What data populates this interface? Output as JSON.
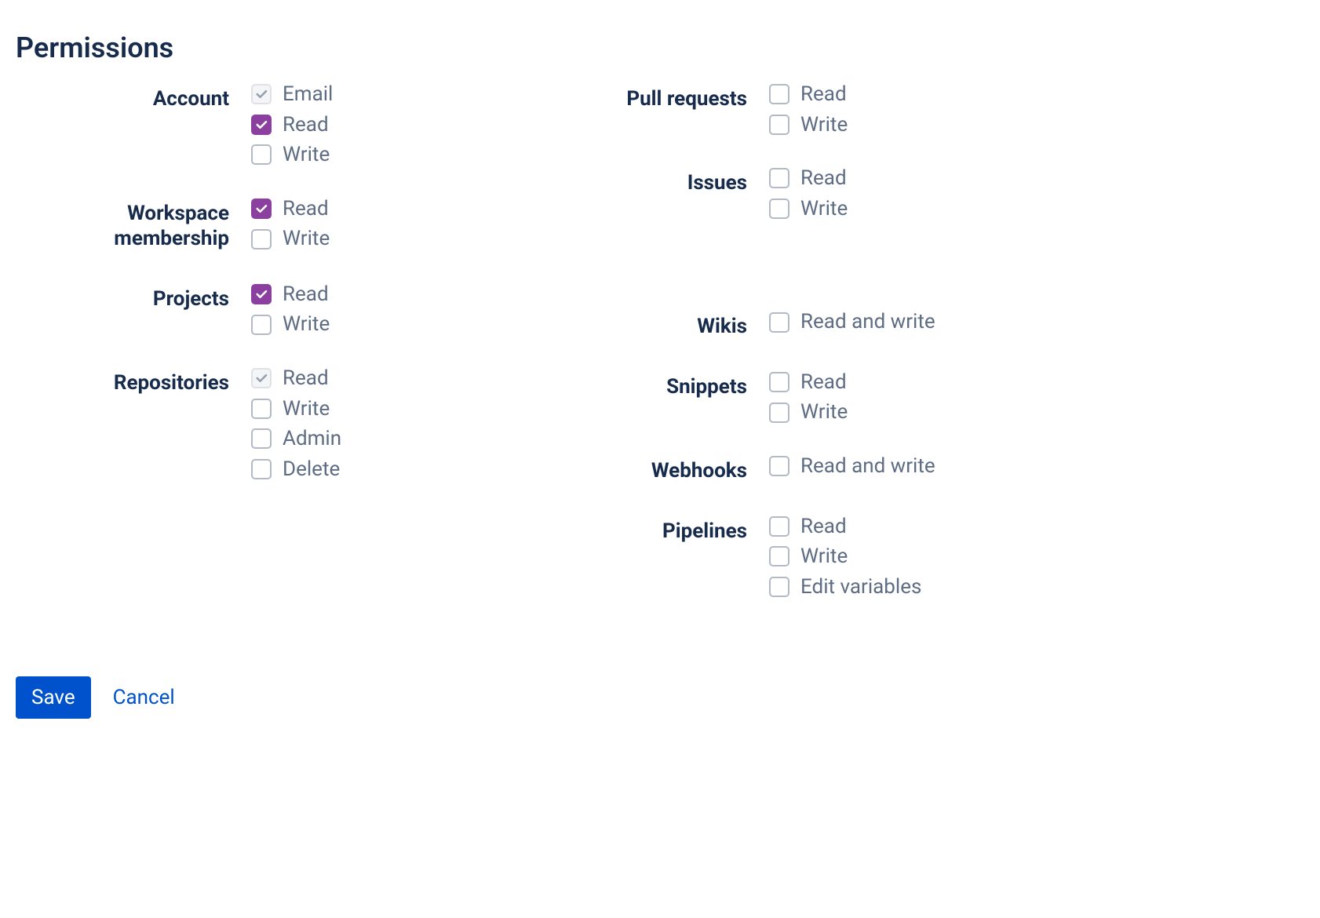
{
  "title": "Permissions",
  "buttons": {
    "save": "Save",
    "cancel": "Cancel"
  },
  "left": [
    {
      "name": "account",
      "label": "Account",
      "options": [
        {
          "name": "email",
          "label": "Email",
          "checked": true,
          "disabled": true
        },
        {
          "name": "read",
          "label": "Read",
          "checked": true,
          "disabled": false
        },
        {
          "name": "write",
          "label": "Write",
          "checked": false,
          "disabled": false
        }
      ]
    },
    {
      "name": "workspace-membership",
      "label": "Workspace membership",
      "options": [
        {
          "name": "read",
          "label": "Read",
          "checked": true,
          "disabled": false
        },
        {
          "name": "write",
          "label": "Write",
          "checked": false,
          "disabled": false
        }
      ]
    },
    {
      "name": "projects",
      "label": "Projects",
      "options": [
        {
          "name": "read",
          "label": "Read",
          "checked": true,
          "disabled": false
        },
        {
          "name": "write",
          "label": "Write",
          "checked": false,
          "disabled": false
        }
      ]
    },
    {
      "name": "repositories",
      "label": "Repositories",
      "options": [
        {
          "name": "read",
          "label": "Read",
          "checked": true,
          "disabled": true
        },
        {
          "name": "write",
          "label": "Write",
          "checked": false,
          "disabled": false
        },
        {
          "name": "admin",
          "label": "Admin",
          "checked": false,
          "disabled": false
        },
        {
          "name": "delete",
          "label": "Delete",
          "checked": false,
          "disabled": false
        }
      ]
    }
  ],
  "right": [
    {
      "name": "pull-requests",
      "label": "Pull requests",
      "options": [
        {
          "name": "read",
          "label": "Read",
          "checked": false,
          "disabled": false
        },
        {
          "name": "write",
          "label": "Write",
          "checked": false,
          "disabled": false
        }
      ]
    },
    {
      "name": "issues",
      "label": "Issues",
      "options": [
        {
          "name": "read",
          "label": "Read",
          "checked": false,
          "disabled": false
        },
        {
          "name": "write",
          "label": "Write",
          "checked": false,
          "disabled": false
        }
      ]
    },
    {
      "name": "wikis",
      "label": "Wikis",
      "spacerBefore": true,
      "options": [
        {
          "name": "read-write",
          "label": "Read and write",
          "checked": false,
          "disabled": false
        }
      ]
    },
    {
      "name": "snippets",
      "label": "Snippets",
      "options": [
        {
          "name": "read",
          "label": "Read",
          "checked": false,
          "disabled": false
        },
        {
          "name": "write",
          "label": "Write",
          "checked": false,
          "disabled": false
        }
      ]
    },
    {
      "name": "webhooks",
      "label": "Webhooks",
      "options": [
        {
          "name": "read-write",
          "label": "Read and write",
          "checked": false,
          "disabled": false
        }
      ]
    },
    {
      "name": "pipelines",
      "label": "Pipelines",
      "options": [
        {
          "name": "read",
          "label": "Read",
          "checked": false,
          "disabled": false
        },
        {
          "name": "write",
          "label": "Write",
          "checked": false,
          "disabled": false
        },
        {
          "name": "edit-variables",
          "label": "Edit variables",
          "checked": false,
          "disabled": false
        }
      ]
    }
  ]
}
